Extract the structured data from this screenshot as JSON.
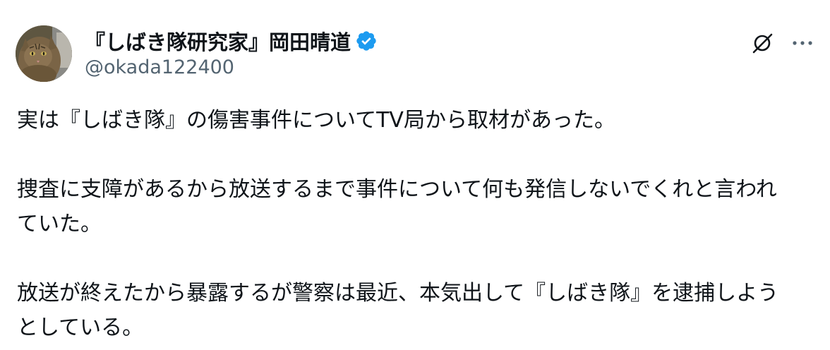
{
  "author": {
    "display_name": "『しばき隊研究家』岡田晴道",
    "handle": "@okada122400",
    "verified": true,
    "avatar": "cat-photo-avatar"
  },
  "actions": {
    "grok_icon": "grok-icon",
    "more_icon": "more-options-icon"
  },
  "colors": {
    "text": "#0f1419",
    "secondary": "#536471",
    "verified": "#1d9bf0"
  },
  "post": {
    "line1": "実は『しばき隊』の傷害事件についてTV局から取材があった。",
    "line2": "捜査に支障があるから放送するまで事件について何も発信しないでくれと言われ",
    "line3": "ていた。",
    "line4": "放送が終えたから暴露するが警察は最近、本気出して『しばき隊』を逮捕しよう",
    "line5": "としている。"
  }
}
